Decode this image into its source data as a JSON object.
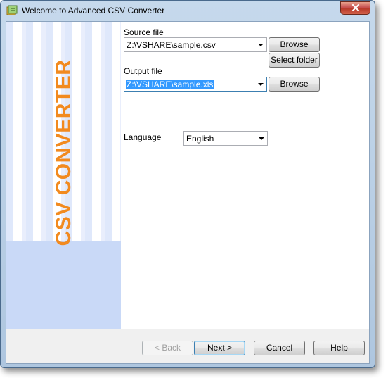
{
  "window": {
    "title": "Welcome to Advanced CSV Converter"
  },
  "side_panel": {
    "title": "CSV CONVERTER"
  },
  "source": {
    "label": "Source file",
    "value": "Z:\\VSHARE\\sample.csv",
    "browse_label": "Browse",
    "select_folder_label": "Select folder"
  },
  "output": {
    "label": "Output file",
    "value": "Z:\\VSHARE\\sample.xls",
    "browse_label": "Browse"
  },
  "language": {
    "label": "Language",
    "value": "English"
  },
  "footer": {
    "back_label": "< Back",
    "next_label": "Next >",
    "cancel_label": "Cancel",
    "help_label": "Help"
  },
  "colors": {
    "accent_title": "#f28a1f",
    "side_panel_bg": "#c9d9f7",
    "selection": "#3399ff"
  }
}
